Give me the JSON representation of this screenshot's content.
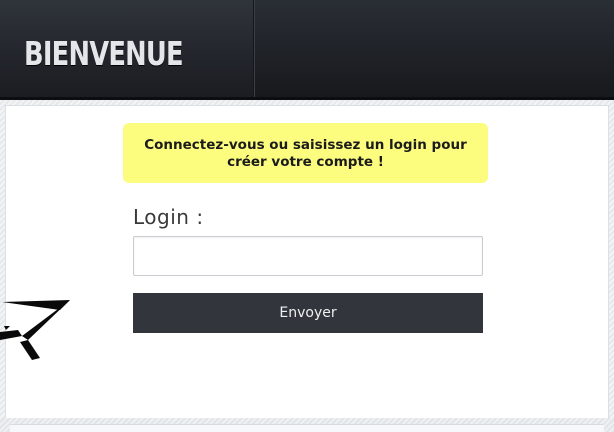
{
  "header": {
    "title": "BIENVENUE"
  },
  "notice": {
    "message": "Connectez-vous ou saisissez un login pour créer votre compte !"
  },
  "form": {
    "login_label": "Login :",
    "login_value": "",
    "submit_label": "Envoyer"
  },
  "colors": {
    "header_bg": "#1f2228",
    "notice_bg": "#fcfc7e",
    "button_bg": "#32363c",
    "button_text": "#eef0f2"
  },
  "icons": {
    "arrow": "hand-drawn-arrow-icon"
  }
}
